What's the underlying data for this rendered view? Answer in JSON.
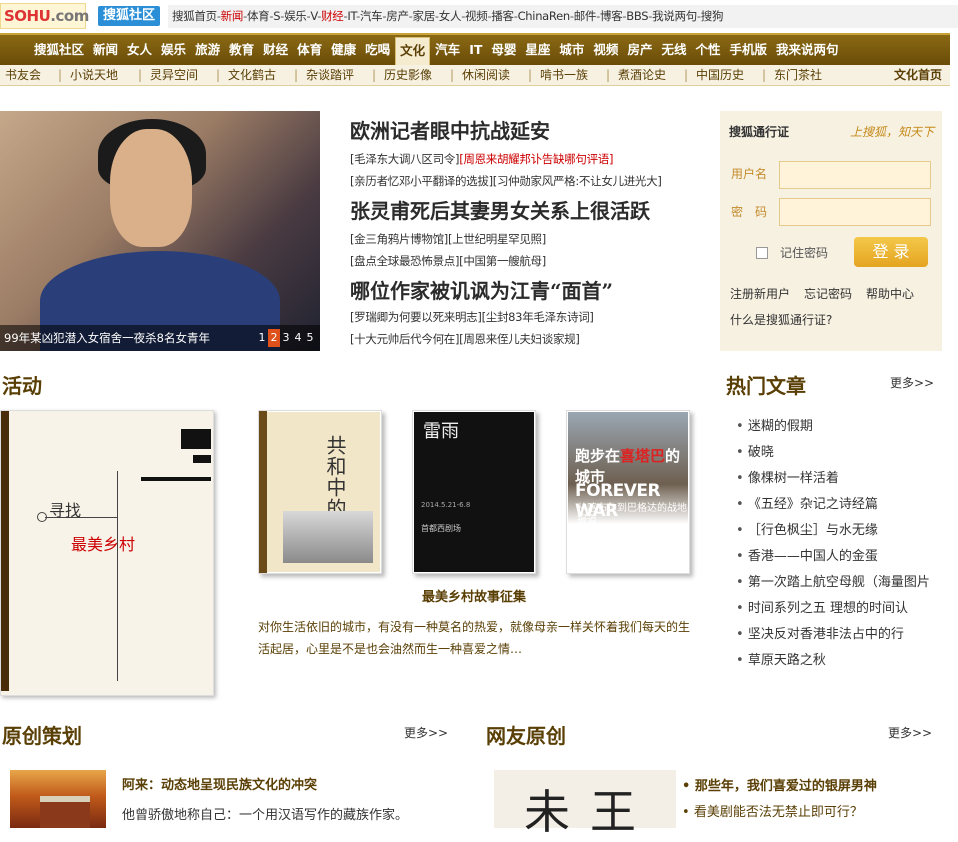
{
  "top": {
    "logo": "SOHU",
    "logo_suffix": ".com",
    "shequ": "搜狐社区",
    "links": [
      "搜狐首页",
      "新闻",
      "体育",
      "S",
      "娱乐",
      "V",
      "财经",
      "IT",
      "汽车",
      "房产",
      "家居",
      "女人",
      "视频",
      "播客",
      "ChinaRen",
      "邮件",
      "博客",
      "BBS",
      "我说两句",
      "搜狗"
    ],
    "red_links": [
      "新闻",
      "财经"
    ]
  },
  "mainnav": [
    "搜狐社区",
    "新闻",
    "女人",
    "娱乐",
    "旅游",
    "教育",
    "财经",
    "体育",
    "健康",
    "吃喝",
    "文化",
    "汽车",
    "IT",
    "母婴",
    "星座",
    "城市",
    "视频",
    "房产",
    "无线",
    "个性",
    "手机版",
    "我来说两句"
  ],
  "mainnav_active": "文化",
  "subnav": {
    "items": [
      "书友会",
      "小说天地",
      "灵异空间",
      "文化鹤古",
      "杂谈踏评",
      "历史影像",
      "休闲阅读",
      "啃书一族",
      "煮酒论史",
      "中国历史",
      "东门茶社"
    ],
    "home": "文化首页"
  },
  "hero": {
    "caption": "99年某凶犯潜入女宿舍一夜杀8名女青年",
    "pages": [
      "1",
      "2",
      "3",
      "4",
      "5"
    ],
    "active_page": "2"
  },
  "news": {
    "h1": "欧洲记者眼中抗战延安",
    "s1a_pre": "[毛泽东大调八区司令]",
    "s1a_red": "[周恩来胡耀邦讣告缺哪句评语]",
    "s1b": "[亲历者忆邓小平翻译的选拔][习仲勋家风严格:不让女儿进光大]",
    "h2": "张灵甫死后其妻男女关系上很活跃",
    "s2a": "[金三角鸦片博物馆][上世纪明星罕见照]",
    "s2b": "[盘点全球最恐怖景点][中国第一艘航母]",
    "h3": "哪位作家被讥讽为江青“面首”",
    "s3a": "[罗瑞卿为何要以死来明志][尘封83年毛泽东诗词]",
    "s3b": "[十大元帅后代今何在][周恩来侄儿夫妇谈家规]"
  },
  "login": {
    "title": "搜狐通行证",
    "slogan": "上搜狐，知天下",
    "username_label": "用户名",
    "password_label": "密　码",
    "remember": "记住密码",
    "button": "登 录",
    "links": [
      "注册新用户",
      "忘记密码",
      "帮助中心"
    ],
    "question": "什么是搜狐通行证?"
  },
  "activity": {
    "title": "活动",
    "bigbook_xun": "寻找",
    "bigbook_title": "最美乡村",
    "book1_title": "共和中的帝制",
    "book2_title": "雷雨",
    "book2_date": "2014.5.21-6.8",
    "book2_venue": "首都西剧场",
    "book3_line1": "跑步在",
    "book3_line1_red": "喜塔巴",
    "book3_line1_end": "的城市",
    "book3_line2": "FOREVER WAR",
    "book3_line3": "从喀布尔到巴格达的战地报道",
    "event_title": "最美乡村故事征集",
    "event_desc": "对你生活依旧的城市，有没有一种莫名的热爱，就像母亲一样关怀着我们每天的生活起居，心里是不是也会油然而生一种喜爱之情…"
  },
  "hot": {
    "title": "热门文章",
    "more": "更多>>",
    "items": [
      "迷糊的假期",
      "破晓",
      "像棵树一样活着",
      "《五经》杂记之诗经篇",
      "［行色枫尘］与水无缘",
      "香港——中国人的金蛋",
      "第一次踏上航空母舰（海量图片",
      "时间系列之五 理想的时间认",
      "坚决反对香港非法占中的行",
      "草原天路之秋"
    ]
  },
  "original": {
    "title": "原创策划",
    "more": "更多>>",
    "headline": "阿来：动态地呈现民族文化的冲突",
    "text": "他曾骄傲地称自己：一个用汉语写作的藏族作家。"
  },
  "netizen": {
    "title": "网友原创",
    "more": "更多>>",
    "calligraphy": "未王",
    "items": [
      "那些年，我们喜爱过的银屏男神",
      "看美剧能否法无禁止即可行？"
    ]
  }
}
